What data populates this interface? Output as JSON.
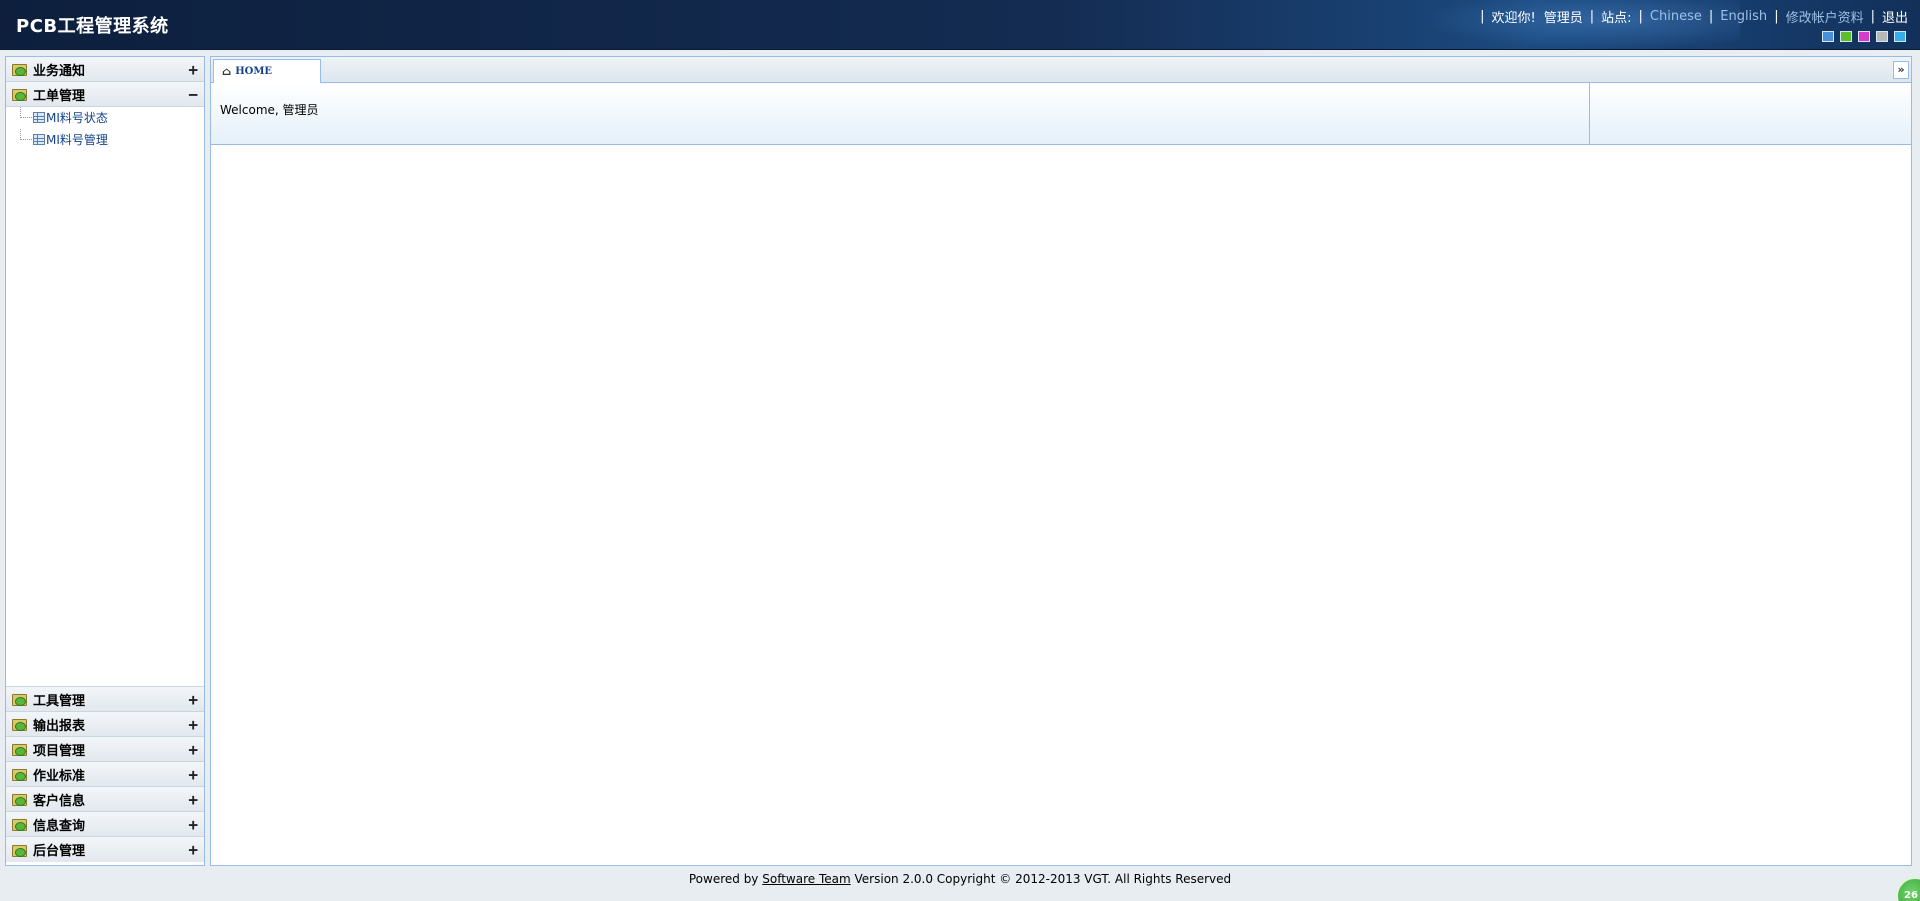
{
  "header": {
    "title": "PCB工程管理系统",
    "welcome": "欢迎你!",
    "username": "管理员",
    "site_label": "站点:",
    "lang_chinese": "Chinese",
    "lang_english": "English",
    "edit_account": "修改帐户资料",
    "logout": "退出",
    "theme_colors": [
      "#4a90d9",
      "#5cbf2a",
      "#d63bd0",
      "#b8b8b8",
      "#37aee8"
    ]
  },
  "sidebar": {
    "sections": [
      {
        "label": "业务通知",
        "toggle": "+"
      },
      {
        "label": "工单管理",
        "toggle": "−",
        "items": [
          "MI料号状态",
          "MI料号管理"
        ]
      },
      {
        "label": "工具管理",
        "toggle": "+"
      },
      {
        "label": "输出报表",
        "toggle": "+"
      },
      {
        "label": "项目管理",
        "toggle": "+"
      },
      {
        "label": "作业标准",
        "toggle": "+"
      },
      {
        "label": "客户信息",
        "toggle": "+"
      },
      {
        "label": "信息查询",
        "toggle": "+"
      },
      {
        "label": "后台管理",
        "toggle": "+"
      }
    ]
  },
  "main": {
    "tab_label": "HOME",
    "welcome_text": "Welcome, 管理员"
  },
  "footer": {
    "prefix": "Powered by",
    "link": "Software Team",
    "suffix": "Version 2.0.0 Copyright © 2012-2013 VGT. All Rights Reserved"
  },
  "badge": "26"
}
